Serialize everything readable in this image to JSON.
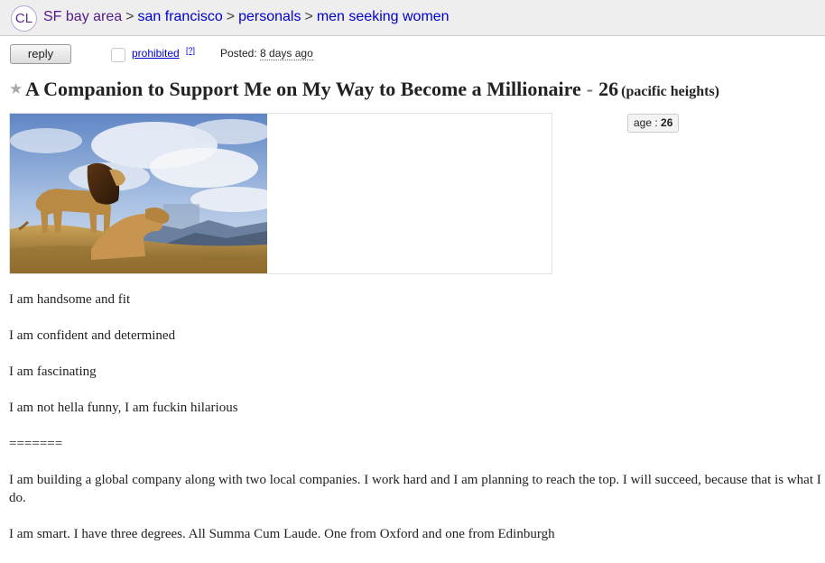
{
  "breadcrumb": {
    "logo": "CL",
    "items": [
      "SF bay area",
      "san francisco",
      "personals",
      "men seeking women"
    ],
    "separator": ">"
  },
  "actions": {
    "reply_label": "reply",
    "prohibited_label": "prohibited",
    "help_label": "[?]",
    "posted_label": "Posted:",
    "posted_value": "8 days ago"
  },
  "post": {
    "title": "A Companion to Support Me on My Way to Become a Millionaire",
    "title_separator": "-",
    "age": "26",
    "location": "(pacific heights)"
  },
  "attributes": {
    "age_label": "age :",
    "age_value": "26"
  },
  "body": {
    "p1": "I am handsome and fit",
    "p2": "I am confident and determined",
    "p3": "I am fascinating",
    "p4": "I am not hella funny, I am fuckin hilarious",
    "p5": "=======",
    "p6": "I am building a global company along with two local companies. I work hard and I am planning to reach the top. I will succeed, because that is what I do.",
    "p7": "I am smart. I have three degrees. All Summa Cum Laude. One from Oxford and one from Edinburgh"
  },
  "colors": {
    "link": "#0000cc",
    "visited": "#551a8b",
    "topbar": "#eeeeee"
  },
  "icons": [
    "craigslist-logo-icon",
    "star-icon",
    "checkbox-icon",
    "lion-photo"
  ]
}
